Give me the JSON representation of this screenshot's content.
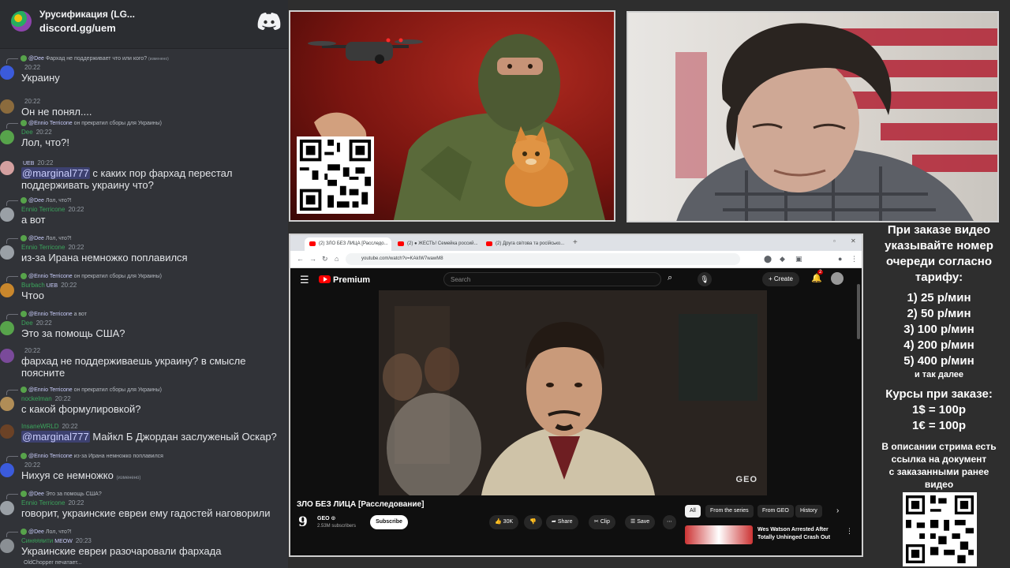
{
  "server": {
    "name": "Урусификация (LG...",
    "invite": "discord.gg/uem"
  },
  "messages": [
    {
      "reply_name": "@Dee",
      "reply_text": "Фархад не поддерживает что или кого?",
      "reply_edited": "(изменено)",
      "user": "",
      "time": "20:22",
      "text": "Украину",
      "avatar_color": "#3b5bdb"
    },
    {
      "reply_name": "",
      "reply_text": "",
      "user": "",
      "time": "20:22",
      "text": "Он не понял....",
      "avatar_color": "#8b6b3d"
    },
    {
      "reply_name": "@Ennio Terricone",
      "reply_text": "он прекратил сборы для Украины)",
      "user": "Dee",
      "time": "20:22",
      "text": "Лол, что?!",
      "avatar_color": "#57a34b"
    },
    {
      "reply_name": "",
      "reply_text": "",
      "user": "",
      "badge": "UEB",
      "time": "20:22",
      "mention": "@marginal777",
      "text": " с каких пор фархад перестал поддерживать украину что?",
      "avatar_color": "#d4a0a0"
    },
    {
      "reply_name": "@Dee",
      "reply_text": "Лол, что?!",
      "user": "Ennio Terricone",
      "time": "20:22",
      "text": "а вот",
      "avatar_color": "#9aa0a6"
    },
    {
      "reply_name": "@Dee",
      "reply_text": "Лол, что?!",
      "user": "Ennio Terricone",
      "time": "20:22",
      "text": "из-за Ирана немножко поплавился",
      "avatar_color": "#9aa0a6"
    },
    {
      "reply_name": "@Ennio Terricone",
      "reply_text": "он прекратил сборы для Украины)",
      "user": "Burbach",
      "badge": "UEB",
      "time": "20:22",
      "text": "Чтоо",
      "avatar_color": "#c9872c"
    },
    {
      "reply_name": "@Ennio Terricone",
      "reply_text": "а вот",
      "user": "Dee",
      "time": "20:22",
      "text": "Это за помощь США?",
      "avatar_color": "#57a34b"
    },
    {
      "reply_name": "",
      "reply_text": "",
      "user": "",
      "time": "20:22",
      "text": "фархад не поддерживаешь украину? в смысле поясните",
      "avatar_color": "#7a4a9a"
    },
    {
      "reply_name": "@Ennio Terricone",
      "reply_text": "он прекратил сборы для Украины)",
      "user": "nockelman",
      "time": "20:22",
      "text": "с какой формулировкой?",
      "avatar_color": "#b08d57"
    },
    {
      "reply_name": "",
      "reply_text": "",
      "user": "InsaneWRLD",
      "time": "20:22",
      "mention": "@marginal777",
      "text": " Майкл Б Джордан заслуженый Оскар?",
      "avatar_color": "#6b4226"
    },
    {
      "reply_name": "@Ennio Terricone",
      "reply_text": "из-за Ирана немножко поплавился",
      "user": "",
      "time": "20:22",
      "text": "Нихуя се немножко",
      "text_edited": "(изменено)",
      "avatar_color": "#3b5bdb"
    },
    {
      "reply_name": "@Dee",
      "reply_text": "Это за помощь США?",
      "user": "Ennio Terricone",
      "time": "20:22",
      "text": "говорит, украинские евреи ему гадостей наговорили",
      "avatar_color": "#9aa0a6"
    },
    {
      "reply_name": "@Dee",
      "reply_text": "Лол, что?!",
      "user": "Синяяяити",
      "badge": "MEOW",
      "time": "20:23",
      "text": "Украинские евреи разочаровали фархада",
      "avatar_color": "#8a8f94"
    }
  ],
  "typing": "OldChopper печатает...",
  "browser": {
    "tabs": [
      "(2) ЗЛО БЕЗ ЛИЦА [Расследо...",
      "(2) ● ЖЕСТЬ! Семейка россий...",
      "(2) Друга світова та російсько..."
    ],
    "url": "youtube.com/watch?v=KAkIW7wawM8"
  },
  "youtube": {
    "logo": "Premium",
    "search_placeholder": "Search",
    "create": "Create",
    "notif_count": "2",
    "watermark": "GEO",
    "title": "ЗЛО БЕЗ ЛИЦА [Расследование]",
    "channel": "GEO ⊙",
    "subs": "2.53M subscribers",
    "subscribe": "Subscribe",
    "likes": "30K",
    "share": "Share",
    "clip": "Clip",
    "save": "Save",
    "chips": [
      "All",
      "From the series",
      "From GEO",
      "History"
    ],
    "rec_title": "Wes Watson Arrested After Totally Unhinged Crash Out"
  },
  "info": {
    "lines": [
      "При заказе видео",
      "указывайте номер",
      "очереди согласно",
      "тарифу:"
    ],
    "prices": [
      "1) 25 р/мин",
      "2) 50 р/мин",
      "3) 100 р/мин",
      "4) 200 р/мин",
      "5) 400 р/мин"
    ],
    "etc": "и так далее",
    "rates_title": "Курсы при заказе:",
    "rates": [
      "1$ = 100р",
      "1€ = 100р"
    ],
    "desc": [
      "В описании стрима есть",
      "ссылка на документ",
      "с заказанными ранее",
      "видео"
    ]
  },
  "colors": {
    "accent_red": "#ff0000",
    "discord_bg": "#313338",
    "mention": "#c9cdfb",
    "username_green": "#3ba55c"
  }
}
